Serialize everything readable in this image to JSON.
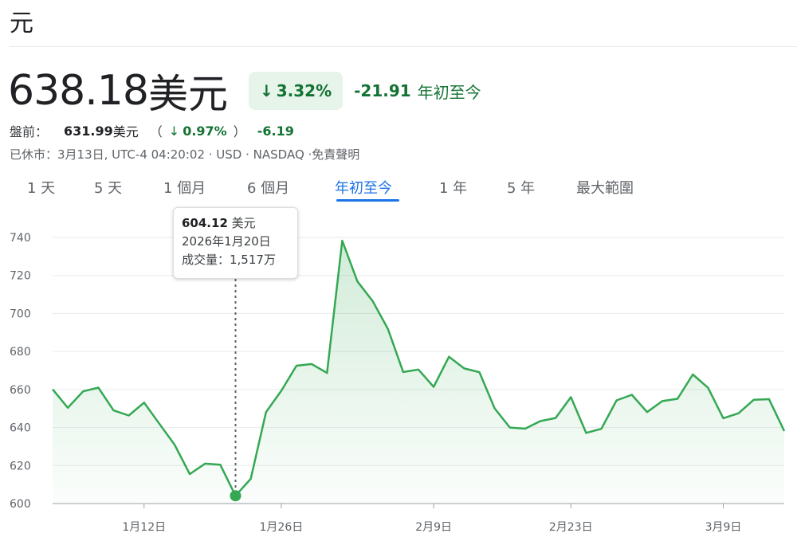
{
  "header": {
    "unit_label": "元",
    "price": "638.18",
    "price_unit": "美元",
    "change_arrow": "↓",
    "change_pct": "3.32%",
    "change_abs": "-21.91",
    "change_period": "年初至今"
  },
  "premarket": {
    "label": "盤前：",
    "price": "631.99",
    "unit": "美元",
    "open_paren": "（",
    "arrow": "↓",
    "pct": "0.97%",
    "close_paren": "）",
    "abs": "-6.19"
  },
  "meta": {
    "text": "已休市：3月13日, UTC-4 04:20:02 · USD · NASDAQ ·免責聲明"
  },
  "tabs": [
    {
      "label": "1 天",
      "active": false
    },
    {
      "label": "5 天",
      "active": false
    },
    {
      "label": "1 個月",
      "active": false
    },
    {
      "label": "6 個月",
      "active": false
    },
    {
      "label": "年初至今",
      "active": true
    },
    {
      "label": "1 年",
      "active": false
    },
    {
      "label": "5 年",
      "active": false
    },
    {
      "label": "最大範圍",
      "active": false
    }
  ],
  "tooltip": {
    "price": "604.12",
    "unit": "美元",
    "date": "2026年1月20日",
    "volume": "成交量：1,517万"
  },
  "colors": {
    "line": "#34a853",
    "fill": "#e6f4ea",
    "up_down_text": "#137333",
    "active_tab": "#1a73e8"
  },
  "chart_data": {
    "type": "area",
    "ylim": [
      600,
      740
    ],
    "yticks": [
      600,
      620,
      640,
      660,
      680,
      700,
      720,
      740
    ],
    "xtick_labels": [
      "1月12日",
      "1月26日",
      "2月9日",
      "2月23日",
      "3月9日"
    ],
    "x": [
      "1月2日",
      "1月5日",
      "1月6日",
      "1月7日",
      "1月8日",
      "1月9日",
      "1月12日",
      "1月13日",
      "1月14日",
      "1月15日",
      "1月16日",
      "1月20日",
      "1月21日",
      "1月22日",
      "1月23日",
      "1月26日",
      "1月27日",
      "1月28日",
      "1月29日",
      "1月30日",
      "2月2日",
      "2月3日",
      "2月4日",
      "2月5日",
      "2月6日",
      "2月9日",
      "2月10日",
      "2月11日",
      "2月12日",
      "2月13日",
      "2月17日",
      "2月18日",
      "2月19日",
      "2月20日",
      "2月23日",
      "2月24日",
      "2月25日",
      "2月26日",
      "2月27日",
      "3月2日",
      "3月3日",
      "3月4日",
      "3月5日",
      "3月6日",
      "3月9日",
      "3月10日",
      "3月11日",
      "3月12日",
      "3月13日"
    ],
    "values": [
      660.1,
      650.4,
      659.0,
      661.0,
      649.0,
      646.3,
      653.1,
      642.0,
      631.0,
      615.5,
      621.0,
      620.4,
      604.1,
      613.0,
      648.1,
      659.3,
      672.5,
      673.4,
      668.7,
      738.3,
      716.8,
      706.5,
      691.8,
      669.2,
      670.5,
      661.4,
      677.2,
      671.1,
      669.1,
      650.1,
      640.0,
      639.4,
      643.4,
      645.0,
      656.0,
      637.2,
      639.3,
      654.3,
      657.2,
      648.1,
      653.9,
      655.1,
      667.9,
      660.9,
      644.9,
      647.5,
      654.6,
      654.9,
      638.2
    ],
    "highlight_index": 12
  }
}
